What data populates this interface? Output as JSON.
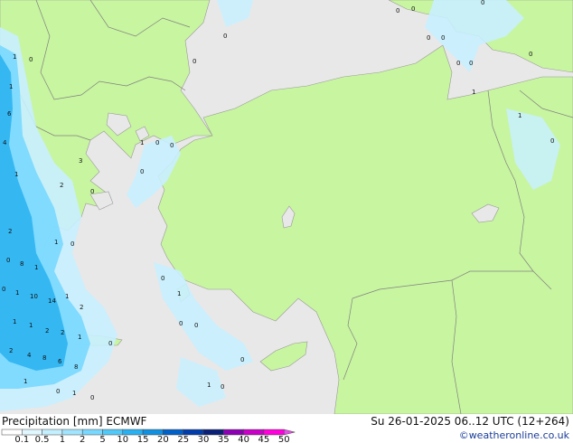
{
  "map": {
    "colors": {
      "sea": "#e8e8e8",
      "land": "#c8f5a0",
      "precip_light": "#c8f0ff",
      "precip_mid": "#78d8ff",
      "precip_heavy": "#28b0f0",
      "coast": "#999999",
      "border": "#808080"
    },
    "value_labels": [
      {
        "id": "v1",
        "text": "1"
      },
      {
        "id": "v2",
        "text": "0"
      },
      {
        "id": "v3",
        "text": "1"
      },
      {
        "id": "v4",
        "text": "6"
      },
      {
        "id": "v5",
        "text": "4"
      },
      {
        "id": "v6",
        "text": "1"
      },
      {
        "id": "v7",
        "text": "3"
      },
      {
        "id": "v8",
        "text": "2"
      },
      {
        "id": "v9",
        "text": "0"
      },
      {
        "id": "v10",
        "text": "2"
      },
      {
        "id": "v11",
        "text": "0"
      },
      {
        "id": "v12",
        "text": "8"
      },
      {
        "id": "v13",
        "text": "1"
      },
      {
        "id": "v14",
        "text": "0"
      },
      {
        "id": "v15",
        "text": "1"
      },
      {
        "id": "v16",
        "text": "10"
      },
      {
        "id": "v17",
        "text": "14"
      },
      {
        "id": "v18",
        "text": "1"
      },
      {
        "id": "v19",
        "text": "2"
      },
      {
        "id": "v20",
        "text": "1"
      },
      {
        "id": "v21",
        "text": "1"
      },
      {
        "id": "v22",
        "text": "2"
      },
      {
        "id": "v23",
        "text": "2"
      },
      {
        "id": "v24",
        "text": "1"
      },
      {
        "id": "v25",
        "text": "2"
      },
      {
        "id": "v26",
        "text": "4"
      },
      {
        "id": "v27",
        "text": "8"
      },
      {
        "id": "v28",
        "text": "6"
      },
      {
        "id": "v29",
        "text": "8"
      },
      {
        "id": "v30",
        "text": "1"
      },
      {
        "id": "v31",
        "text": "0"
      },
      {
        "id": "v32",
        "text": "1"
      },
      {
        "id": "v33",
        "text": "0"
      },
      {
        "id": "v34",
        "text": "0"
      },
      {
        "id": "v35",
        "text": "0"
      },
      {
        "id": "v36",
        "text": "0"
      },
      {
        "id": "v37",
        "text": "0"
      },
      {
        "id": "v38",
        "text": "0"
      },
      {
        "id": "v39",
        "text": "0"
      },
      {
        "id": "v40",
        "text": "0"
      },
      {
        "id": "v41",
        "text": "0"
      },
      {
        "id": "v42",
        "text": "0"
      },
      {
        "id": "v43",
        "text": "0"
      },
      {
        "id": "v44",
        "text": "1"
      },
      {
        "id": "v45",
        "text": "1"
      },
      {
        "id": "v46",
        "text": "0"
      },
      {
        "id": "v47",
        "text": "1"
      },
      {
        "id": "v48",
        "text": "0"
      },
      {
        "id": "v49",
        "text": "0"
      },
      {
        "id": "v50",
        "text": "0"
      },
      {
        "id": "v51",
        "text": "0"
      },
      {
        "id": "v52",
        "text": "1"
      },
      {
        "id": "v53",
        "text": "0"
      },
      {
        "id": "v54",
        "text": "1"
      },
      {
        "id": "v55",
        "text": "0"
      },
      {
        "id": "v56",
        "text": "0"
      },
      {
        "id": "v57",
        "text": "0"
      },
      {
        "id": "v58",
        "text": "1"
      },
      {
        "id": "v59",
        "text": "0"
      },
      {
        "id": "v60",
        "text": "0"
      }
    ]
  },
  "footer": {
    "title": "Precipitation [mm]  ECMWF",
    "run": "Su 26-01-2025 06..12 UTC (12+264)",
    "credit": "©weatheronline.co.uk",
    "scale": {
      "labels": [
        "0.1",
        "0.5",
        "1",
        "2",
        "5",
        "10",
        "15",
        "20",
        "25",
        "30",
        "35",
        "40",
        "45",
        "50"
      ],
      "colors": [
        "#ffffff",
        "#e1f7ff",
        "#c3efff",
        "#a0e4ff",
        "#78d8ff",
        "#50c8f8",
        "#28b0f0",
        "#1090e0",
        "#0060c8",
        "#003caa",
        "#0a2078",
        "#8c00b4",
        "#c800c8",
        "#ff00dc",
        "#e84ce8"
      ]
    }
  }
}
